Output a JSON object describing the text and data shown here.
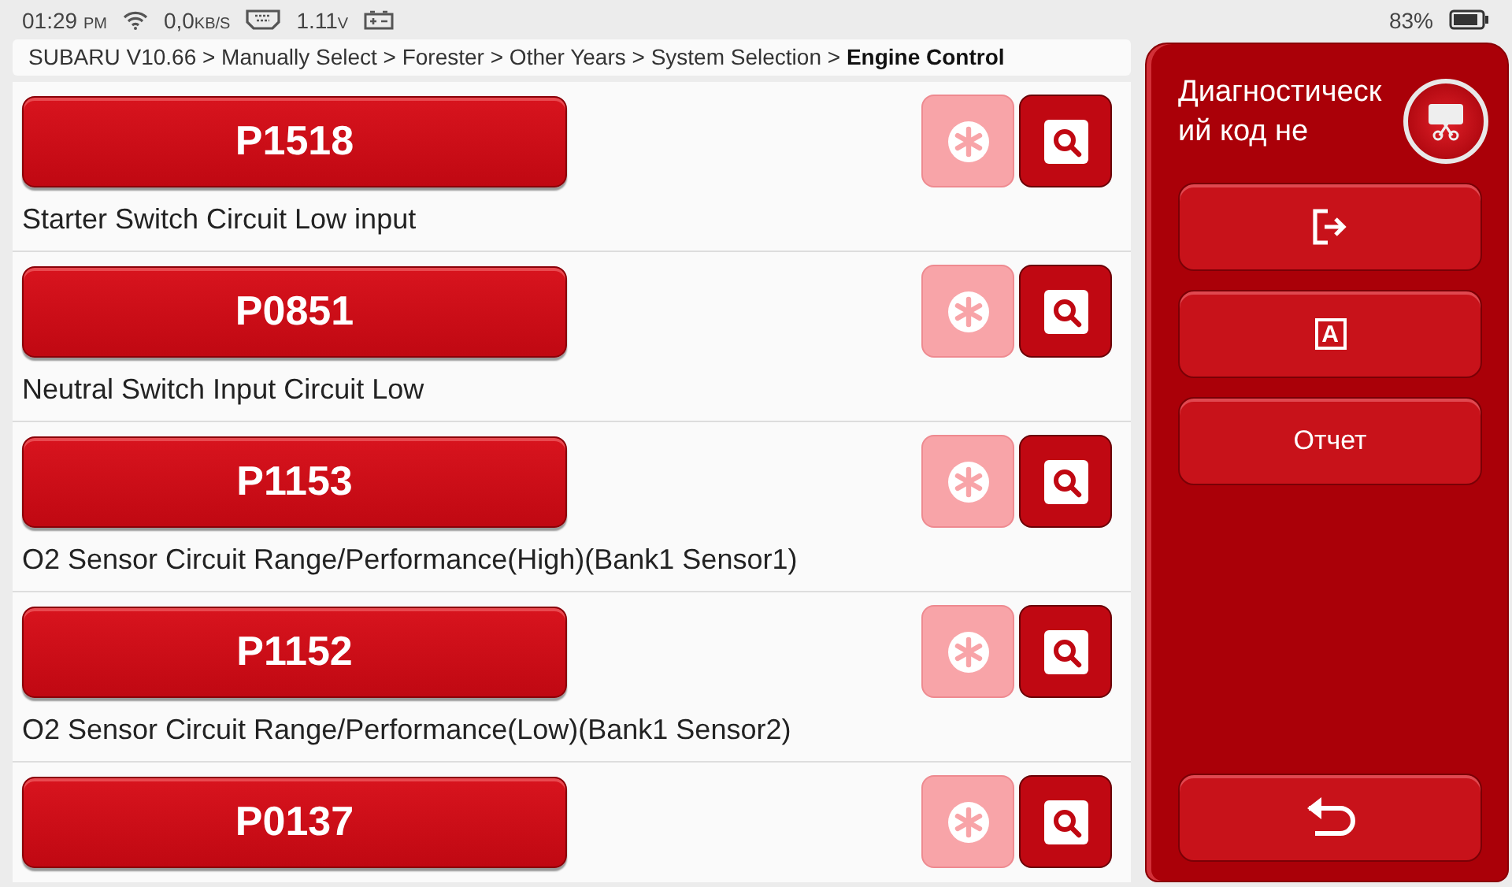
{
  "status_bar": {
    "time": "01:29",
    "ampm": "PM",
    "speed": "0,0",
    "speed_unit": "KB/S",
    "voltage": "1.11",
    "voltage_unit": "V",
    "battery": "83%"
  },
  "breadcrumb": {
    "path": "SUBARU V10.66 > Manually Select > Forester > Other Years > System Selection > ",
    "current": "Engine Control"
  },
  "codes": [
    {
      "code": "P1518",
      "description": "Starter Switch Circuit Low input",
      "freeze_disabled": true
    },
    {
      "code": "P0851",
      "description": "Neutral Switch Input Circuit Low",
      "freeze_disabled": true
    },
    {
      "code": "P1153",
      "description": "O2 Sensor Circuit Range/Performance(High)(Bank1 Sensor1)",
      "freeze_disabled": true
    },
    {
      "code": "P1152",
      "description": "O2 Sensor Circuit Range/Performance(Low)(Bank1 Sensor2)",
      "freeze_disabled": true
    },
    {
      "code": "P0137",
      "freeze_disabled": true
    }
  ],
  "side_panel": {
    "title": "Диагностический код не",
    "buttons": [
      {
        "kind": "exit"
      },
      {
        "kind": "letter",
        "text": "A"
      },
      {
        "kind": "text",
        "text": "Отчет"
      }
    ],
    "back_button": {
      "kind": "back"
    }
  }
}
